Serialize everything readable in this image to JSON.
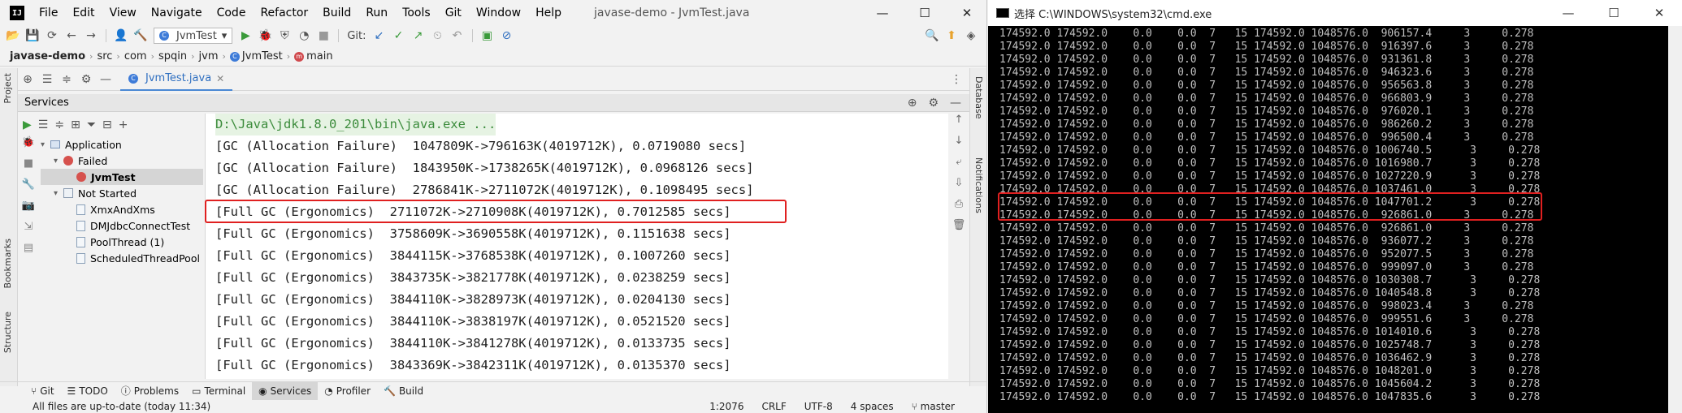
{
  "ide": {
    "app_icon": "IJ",
    "menu": [
      "File",
      "Edit",
      "View",
      "Navigate",
      "Code",
      "Refactor",
      "Build",
      "Run",
      "Tools",
      "Git",
      "Window",
      "Help"
    ],
    "window_title": "javase-demo - JvmTest.java",
    "run_config": "JvmTest",
    "git_label": "Git:",
    "breadcrumb": [
      "javase-demo",
      "src",
      "com",
      "spqin",
      "jvm",
      "JvmTest",
      "main"
    ],
    "editor_tab": "JvmTest.java",
    "services_title": "Services",
    "left_tabs": [
      "Project",
      "Bookmarks",
      "Structure"
    ],
    "right_tabs": [
      "Database",
      "Notifications"
    ],
    "tree": {
      "application": "Application",
      "failed": "Failed",
      "failed_item": "JvmTest",
      "not_started": "Not Started",
      "items": [
        "XmxAndXms",
        "DMJdbcConnectTest",
        "PoolThread (1)",
        "ScheduledThreadPool"
      ]
    },
    "console": {
      "command": "D:\\Java\\jdk1.8.0_201\\bin\\java.exe ...",
      "lines": [
        "[GC (Allocation Failure)  1047809K->796163K(4019712K), 0.0719080 secs]",
        "[GC (Allocation Failure)  1843950K->1738265K(4019712K), 0.0968126 secs]",
        "[GC (Allocation Failure)  2786841K->2711072K(4019712K), 0.1098495 secs]",
        "[Full GC (Ergonomics)  2711072K->2710908K(4019712K), 0.7012585 secs]",
        "[Full GC (Ergonomics)  3758609K->3690558K(4019712K), 0.1151638 secs]",
        "[Full GC (Ergonomics)  3844115K->3768538K(4019712K), 0.1007260 secs]",
        "[Full GC (Ergonomics)  3843735K->3821778K(4019712K), 0.0238259 secs]",
        "[Full GC (Ergonomics)  3844110K->3828973K(4019712K), 0.0204130 secs]",
        "[Full GC (Ergonomics)  3844110K->3838197K(4019712K), 0.0521520 secs]",
        "[Full GC (Ergonomics)  3844110K->3841278K(4019712K), 0.0133735 secs]",
        "[Full GC (Ergonomics)  3843369K->3842311K(4019712K), 0.0135370 secs]"
      ]
    },
    "bottom_tabs": [
      "Git",
      "TODO",
      "Problems",
      "Terminal",
      "Services",
      "Profiler",
      "Build"
    ],
    "status": {
      "message": "All files are up-to-date (today 11:34)",
      "position": "1:2076",
      "line_sep": "CRLF",
      "encoding": "UTF-8",
      "indent": "4 spaces",
      "branch": "master"
    }
  },
  "cmd": {
    "title": "选择 C:\\WINDOWS\\system32\\cmd.exe",
    "rows": [
      "174592.0 174592.0    0.0    0.0  7   15 174592.0 1048576.0  906157.4     3     0.278",
      "174592.0 174592.0    0.0    0.0  7   15 174592.0 1048576.0  916397.6     3     0.278",
      "174592.0 174592.0    0.0    0.0  7   15 174592.0 1048576.0  931361.8     3     0.278",
      "174592.0 174592.0    0.0    0.0  7   15 174592.0 1048576.0  946323.6     3     0.278",
      "174592.0 174592.0    0.0    0.0  7   15 174592.0 1048576.0  956563.8     3     0.278",
      "174592.0 174592.0    0.0    0.0  7   15 174592.0 1048576.0  966803.9     3     0.278",
      "174592.0 174592.0    0.0    0.0  7   15 174592.0 1048576.0  976020.1     3     0.278",
      "174592.0 174592.0    0.0    0.0  7   15 174592.0 1048576.0  986260.2     3     0.278",
      "174592.0 174592.0    0.0    0.0  7   15 174592.0 1048576.0  996500.4     3     0.278",
      "174592.0 174592.0    0.0    0.0  7   15 174592.0 1048576.0 1006740.5      3     0.278",
      "174592.0 174592.0    0.0    0.0  7   15 174592.0 1048576.0 1016980.7      3     0.278",
      "174592.0 174592.0    0.0    0.0  7   15 174592.0 1048576.0 1027220.9      3     0.278",
      "174592.0 174592.0    0.0    0.0  7   15 174592.0 1048576.0 1037461.0      3     0.278",
      "174592.0 174592.0    0.0    0.0  7   15 174592.0 1048576.0 1047701.2      3     0.278",
      "174592.0 174592.0    0.0    0.0  7   15 174592.0 1048576.0  926861.0     3     0.278",
      "174592.0 174592.0    0.0    0.0  7   15 174592.0 1048576.0  926861.0     3     0.278",
      "174592.0 174592.0    0.0    0.0  7   15 174592.0 1048576.0  936077.2     3     0.278",
      "174592.0 174592.0    0.0    0.0  7   15 174592.0 1048576.0  952077.5     3     0.278",
      "174592.0 174592.0    0.0    0.0  7   15 174592.0 1048576.0  999097.0     3     0.278",
      "174592.0 174592.0    0.0    0.0  7   15 174592.0 1048576.0 1030308.7      3     0.278",
      "174592.0 174592.0    0.0    0.0  7   15 174592.0 1048576.0 1040548.8      3     0.278",
      "174592.0 174592.0    0.0    0.0  7   15 174592.0 1048576.0  998023.4     3     0.278",
      "174592.0 174592.0    0.0    0.0  7   15 174592.0 1048576.0  999551.6     3     0.278",
      "174592.0 174592.0    0.0    0.0  7   15 174592.0 1048576.0 1014010.6      3     0.278",
      "174592.0 174592.0    0.0    0.0  7   15 174592.0 1048576.0 1025748.7      3     0.278",
      "174592.0 174592.0    0.0    0.0  7   15 174592.0 1048576.0 1036462.9      3     0.278",
      "174592.0 174592.0    0.0    0.0  7   15 174592.0 1048576.0 1048201.0      3     0.278",
      "174592.0 174592.0    0.0    0.0  7   15 174592.0 1048576.0 1045604.2      3     0.278",
      "174592.0 174592.0    0.0    0.0  7   15 174592.0 1048576.0 1047835.6      3     0.278"
    ]
  },
  "colors": {
    "highlight_box": "#e02020",
    "console_cmd": "#3c8c3c",
    "accent": "#4a88d4"
  }
}
